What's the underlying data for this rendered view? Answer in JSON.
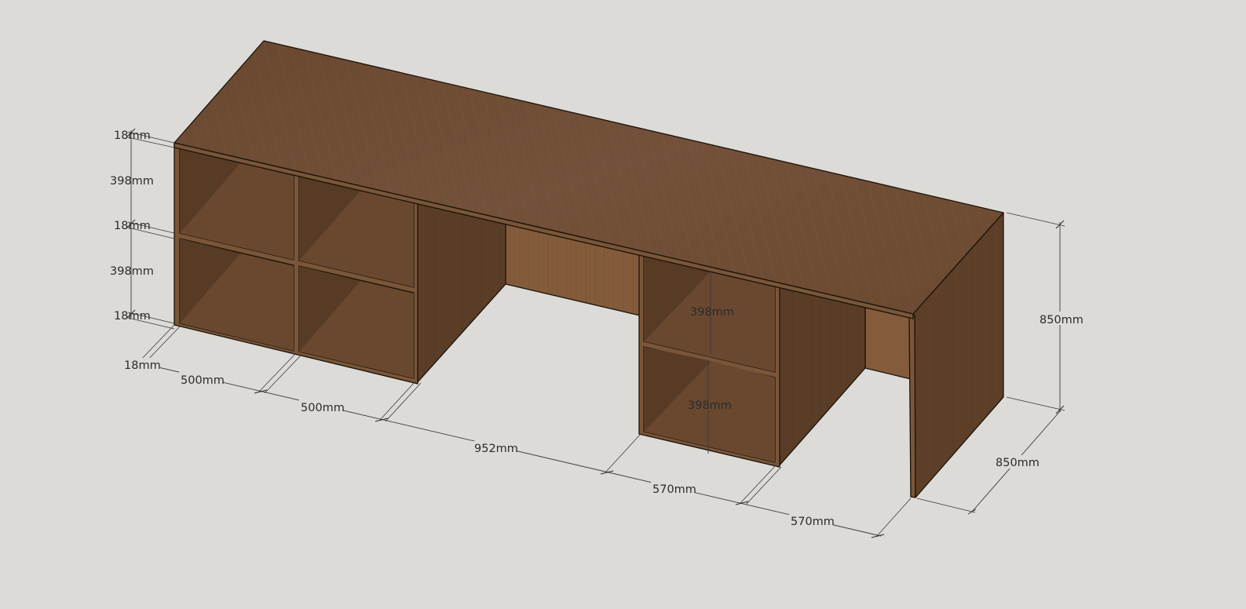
{
  "dimensions": {
    "shelf_thickness_top": "18mm",
    "shelf_opening_upper": "398mm",
    "shelf_thickness_middle": "18mm",
    "shelf_opening_lower": "398mm",
    "shelf_thickness_bottom": "18mm",
    "side_panel_thickness": "18mm",
    "cube_width_left": "500mm",
    "cube_width_right": "500mm",
    "knee_gap_width": "952mm",
    "drawer_cube_width": "570mm",
    "end_leg_gap_width": "570mm",
    "desk_height": "850mm",
    "desk_depth": "850mm",
    "drawer_cube_opening_upper": "398mm",
    "drawer_cube_opening_lower": "398mm"
  },
  "colors": {
    "background": "#dcdbd8",
    "wood_top": "#6e4c32",
    "wood_front_edge": "#7a5638",
    "wood_side_dark": "#5a3d27",
    "wood_inner_shadow": "#4f3522",
    "wood_back_panel": "#845c3b",
    "outline": "#1a1209",
    "dimension_line": "#3a3a3a"
  }
}
